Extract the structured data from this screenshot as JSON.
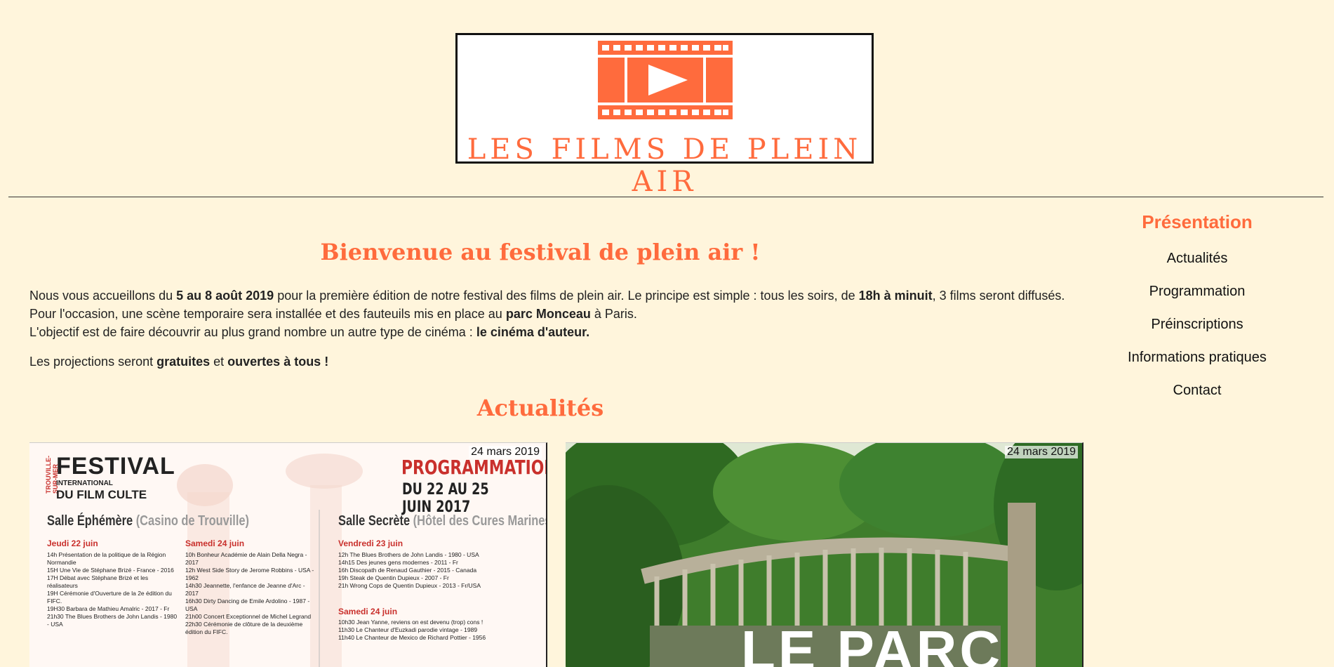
{
  "logo": {
    "text": "LES FILMS DE PLEIN AIR",
    "color": "#ff6b3d",
    "icon": "film-play-icon"
  },
  "nav": {
    "items": [
      {
        "label": "Présentation",
        "active": true
      },
      {
        "label": "Actualités"
      },
      {
        "label": "Programmation"
      },
      {
        "label": "Préinscriptions"
      },
      {
        "label": "Informations pratiques"
      },
      {
        "label": "Contact"
      }
    ]
  },
  "welcome": {
    "title": "Bienvenue au festival de plein air !",
    "l1a": "Nous vous accueillons du ",
    "l1b": "5 au 8 août 2019",
    "l1c": " pour la première édition de notre festival des films de plein air. Le principe est simple : tous les soirs, de ",
    "l1d": "18h à minuit",
    "l1e": ", 3 films seront diffusés.",
    "l2a": "Pour l'occasion, une scène temporaire sera installée et des fauteuils mis en place au ",
    "l2b": "parc Monceau",
    "l2c": " à Paris.",
    "l3a": "L'objectif est de faire découvrir au plus grand nombre un autre type de cinéma : ",
    "l3b": "le cinéma d'auteur.",
    "l4a": "Les projections seront ",
    "l4b": "gratuites",
    "l4c": " et ",
    "l4d": "ouvertes à tous !"
  },
  "news": {
    "title": "Actualités",
    "cards": [
      {
        "date": "24 mars 2019",
        "poster": {
          "festival": "FESTIVAL",
          "intl": "INTERNATIONAL",
          "film": "DU FILM CULTE",
          "prog": "PROGRAMMATION",
          "dates": "DU 22 AU 25 JUIN 2017",
          "salle1": "Salle Éphémère",
          "salle1b": " (Casino de Trouville)",
          "salle2": "Salle Secrète",
          "salle2b": " (Hôtel des Cures Marines)",
          "day1": "Jeudi 22 juin",
          "day2": "Samedi 24 juin",
          "day3": "Vendredi 23 juin",
          "day4": "Samedi 24 juin",
          "col1": [
            "14h  Présentation de la politique de la Région Normandie",
            "15H  Une Vie de Stéphane Brizé - France - 2016",
            "17H  Débat avec Stéphane Brizé et les réalisateurs",
            "19H  Cérémonie d'Ouverture de la 2e édition du FIFC.",
            "19H30  Barbara de Mathieu Amalric - 2017 - Fr",
            "21h30  The Blues Brothers de John Landis - 1980 - USA"
          ],
          "col2": [
            "10h  Bonheur Académie de Alain Della Negra - 2017",
            "12h  West Side Story de Jerome Robbins - USA - 1962",
            "14h30  Jeannette, l'enfance de Jeanne d'Arc - 2017",
            "16h30  Dirty Dancing de Emile Ardolino - 1987 - USA",
            "21h00  Concert Exceptionnel de Michel Legrand",
            "22h30  Cérémonie de clôture de la deuxième édition du FIFC."
          ],
          "col3": [
            "12h  The Blues Brothers de John Landis - 1980 - USA",
            "14h15  Des jeunes gens modernes - 2011 - Fr",
            "16h  Discopath de Renaud Gauthier - 2015 - Canada",
            "19h  Steak de Quentin Dupieux - 2007 - Fr",
            "21h  Wrong Cops de Quentin Dupieux - 2013 - Fr/USA"
          ],
          "col4": [
            "10h30  Jean Yanne, reviens on est devenu (trop) cons !",
            "11h30  Le Chanteur d'Euzkadi parodie vintage - 1989",
            "11h40  Le Chanteur de Mexico de Richard Pottier - 1956"
          ]
        }
      },
      {
        "date": "24 mars 2019",
        "overlay": "LE PARC"
      }
    ]
  }
}
